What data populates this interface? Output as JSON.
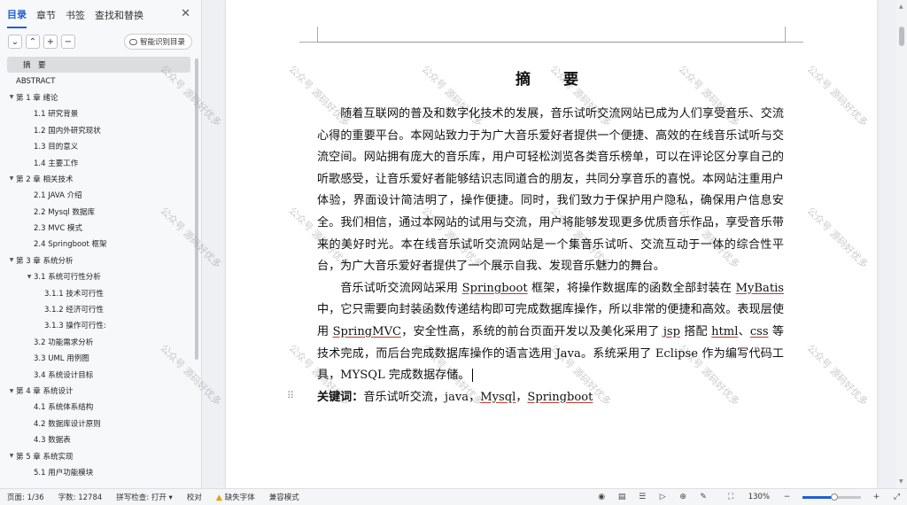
{
  "nav": {
    "tabs": [
      "目录",
      "章节",
      "书签",
      "查找和替换"
    ],
    "active_tab": 0,
    "close_label": "✕",
    "smart_toc_label": "智能识别目录",
    "toc": [
      {
        "label": "摘　要",
        "level": 1,
        "arrow": "",
        "active": true
      },
      {
        "label": "ABSTRACT",
        "level": 1,
        "arrow": ""
      },
      {
        "label": "第 1 章  绪论",
        "level": 1,
        "arrow": "▼"
      },
      {
        "label": "1.1  研究背景",
        "level": 2,
        "arrow": ""
      },
      {
        "label": "1.2  国内外研究现状",
        "level": 2,
        "arrow": ""
      },
      {
        "label": "1.3  目的意义",
        "level": 2,
        "arrow": ""
      },
      {
        "label": "1.4  主要工作",
        "level": 2,
        "arrow": ""
      },
      {
        "label": "第 2 章  相关技术",
        "level": 1,
        "arrow": "▼"
      },
      {
        "label": "2.1 JAVA 介绍",
        "level": 2,
        "arrow": ""
      },
      {
        "label": "2.2 Mysql 数据库",
        "level": 2,
        "arrow": ""
      },
      {
        "label": "2.3 MVC 模式",
        "level": 2,
        "arrow": ""
      },
      {
        "label": "2.4 Springboot 框架",
        "level": 2,
        "arrow": ""
      },
      {
        "label": "第 3 章  系统分析",
        "level": 1,
        "arrow": "▼"
      },
      {
        "label": "3.1  系统可行性分析",
        "level": 2,
        "arrow": "▼"
      },
      {
        "label": "3.1.1 技术可行性",
        "level": 3,
        "arrow": ""
      },
      {
        "label": "3.1.2 经济可行性",
        "level": 3,
        "arrow": ""
      },
      {
        "label": "3.1.3 操作可行性:",
        "level": 3,
        "arrow": ""
      },
      {
        "label": "3.2  功能需求分析",
        "level": 2,
        "arrow": ""
      },
      {
        "label": "3.3 UML 用例图",
        "level": 2,
        "arrow": ""
      },
      {
        "label": "3.4  系统设计目标",
        "level": 2,
        "arrow": ""
      },
      {
        "label": "第 4 章  系统设计",
        "level": 1,
        "arrow": "▼"
      },
      {
        "label": "4.1  系统体系结构",
        "level": 2,
        "arrow": ""
      },
      {
        "label": "4.2  数据库设计原则",
        "level": 2,
        "arrow": ""
      },
      {
        "label": "4.3  数据表",
        "level": 2,
        "arrow": ""
      },
      {
        "label": "第 5 章  系统实现",
        "level": 1,
        "arrow": "▼"
      },
      {
        "label": "5.1  用户功能模块",
        "level": 2,
        "arrow": ""
      }
    ]
  },
  "doc": {
    "title": "摘　要",
    "para1": "随着互联网的普及和数字化技术的发展，音乐试听交流网站已成为人们享受音乐、交流心得的重要平台。本网站致力于为广大音乐爱好者提供一个便捷、高效的在线音乐试听与交流空间。网站拥有庞大的音乐库，用户可轻松浏览各类音乐榜单，可以在评论区分享自己的听歌感受，让音乐爱好者能够结识志同道合的朋友，共同分享音乐的喜悦。本网站注重用户体验，界面设计简洁明了，操作便捷。同时，我们致力于保护用户隐私，确保用户信息安全。我们相信，通过本网站的试用与交流，用户将能够发现更多优质音乐作品，享受音乐带来的美好时光。本在线音乐试听交流网站是一个集音乐试听、交流互动于一体的综合性平台，为广大音乐爱好者提供了一个展示自我、发现音乐魅力的舞台。",
    "para2": {
      "t1": "音乐试听交流网站采用 ",
      "w1": "Springboot",
      "t2": " 框架，将操作数据库的函数全部封装在 ",
      "w2": "MyBatis",
      "t3": " 中，它只需要向封装函数传递结构即可完成数据库操作，所以非常的便捷和高效。表现层使用 ",
      "w3": "SpringMVC",
      "t4": "，安全性高，系统的前台页面开发以及美化采用了 ",
      "w4": "jsp",
      "t5": " 搭配 ",
      "w5": "html",
      "t6": "、",
      "w6": "css",
      "t7": " 等技术完成，而后台完成数据库操作的语言选用 Java。系统采用了 Eclipse 作为编写代码工具，MYSQL 完成数据存储。"
    },
    "keywords_label": "关键词：",
    "keywords_text": "音乐试听交流，java，",
    "kw_mysql": "Mysql",
    "kw_sep": "，",
    "kw_springboot": "Springboot",
    "watermark": "公众号 源码好优多"
  },
  "status": {
    "page": "页面: 1/36",
    "words": "字数: 12784",
    "spell": "拼写检查: 打开 ▾",
    "proof": "校对",
    "missing_font": "缺失字体",
    "compat": "兼容模式",
    "zoom": "130%",
    "zoom_fraction": 0.55
  }
}
